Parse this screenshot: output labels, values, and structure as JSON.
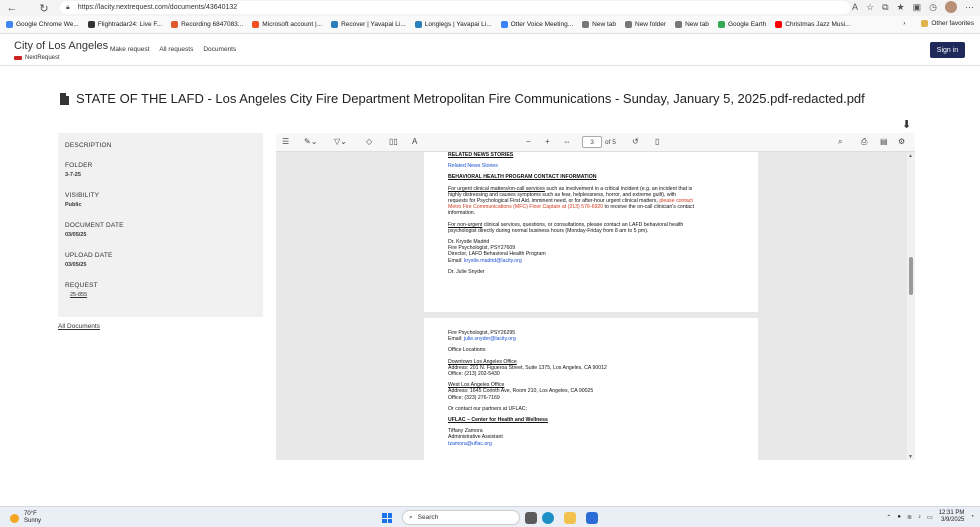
{
  "browser": {
    "url": "https://lacity.nextrequest.com/documents/43640132",
    "bookmarks": [
      {
        "label": "Google Chrome We...",
        "color": "#4285f4"
      },
      {
        "label": "Flightradar24: Live F...",
        "color": "#333333"
      },
      {
        "label": "Recording 6847083...",
        "color": "#e25c2b"
      },
      {
        "label": "Microsoft account |...",
        "color": "#f25022"
      },
      {
        "label": "Recover | Yavapai Li...",
        "color": "#2a7fbd"
      },
      {
        "label": "Longlegs | Yavapai Li...",
        "color": "#2a7fbd"
      },
      {
        "label": "Otter Voice Meeting...",
        "color": "#3b82f6"
      },
      {
        "label": "New tab",
        "color": "#777777"
      },
      {
        "label": "New folder",
        "color": "#777777"
      },
      {
        "label": "New tab",
        "color": "#777777"
      },
      {
        "label": "Google Earth",
        "color": "#34a853"
      },
      {
        "label": "Christmas Jazz Musi...",
        "color": "#ff0000"
      }
    ],
    "other_favorites": "Other favorites"
  },
  "site": {
    "brand": "City of Los Angeles",
    "brand_sub": "NextRequest",
    "nav": {
      "make_request": "Make request",
      "all_requests": "All requests",
      "documents": "Documents"
    },
    "sign_in": "Sign in"
  },
  "document": {
    "title": "STATE OF THE LAFD - Los Angeles City Fire Department Metropolitan Fire Communications - Sunday, January 5, 2025.pdf-redacted.pdf"
  },
  "sidebar": {
    "description_label": "DESCRIPTION",
    "folder_label": "FOLDER",
    "folder_value": "3-7-25",
    "visibility_label": "VISIBILITY",
    "visibility_value": "Public",
    "document_date_label": "DOCUMENT DATE",
    "document_date_value": "03/05/25",
    "upload_date_label": "UPLOAD DATE",
    "upload_date_value": "03/05/25",
    "request_label": "REQUEST",
    "request_value": "25-855",
    "all_documents": "All Documents"
  },
  "viewer": {
    "current_page": "3",
    "total_pages": "of 5",
    "zoom_minus": "−",
    "zoom_plus": "+"
  },
  "page1": {
    "related_heading": "RELATED NEWS STORIES",
    "related_link": "Related News Stories",
    "bhp_heading": "BEHAVIORAL HEALTH PROGRAM CONTACT INFORMATION",
    "urgent_1a": "For urgent clinical matters/on-call services",
    "urgent_1b": " such as involvement in a critical incident (e.g. an incident that is",
    "urgent_2": "highly distressing and causes symptoms such as fear, helplessness, horror, and extreme guilt), with",
    "urgent_3a": "requests for Psychological First Aid, imminent need, or for after-hour urgent clinical matters, ",
    "urgent_3b": "please contact",
    "urgent_4a": "Metro Fire Communications (MFC) Floor Captain at (213) 576-6920",
    "urgent_4b": " to receive the on-call clinician's contact",
    "urgent_5": "information.",
    "nonurgent_1a": "For non-urgent",
    "nonurgent_1b": " clinical services, questions, or consultations, please contact an LAFD behavioral health",
    "nonurgent_2": "psychologist directly during normal business hours (Monday-Friday from 8 am to 5 pm).",
    "madrid_name": "Dr. Krystle Madrid",
    "madrid_title": "Fire Psychologist, PSY27609",
    "madrid_role": "Director, LAFD Behavioral Health Program",
    "madrid_email_label": "Email: ",
    "madrid_email": "krystle.madrid@lacity.org",
    "snyder_name": "Dr. Julie Snyder"
  },
  "page2": {
    "snyder_title": "Fire Psychologist, PSY26295",
    "snyder_email_label": "Email: ",
    "snyder_email": "julie.snyder@lacity.org",
    "office_locations": "Office Locations:",
    "downtown_heading": "Downtown Los Angeles Office",
    "downtown_address": "Address: 201 N. Figueroa Street, Suite 1375, Los Angeles, CA 90012",
    "downtown_phone": "Office: (213) 202-5430",
    "west_heading": "West Los Angeles Office",
    "west_address": "Address: 1645 Corinth Ave, Room 210, Los Angeles, CA 90025",
    "west_phone": "Office: (323) 276-7169",
    "partners": "Or contact our partners at UFLAC:",
    "uflac_heading": "UFLAC – Center for Health and Wellness",
    "tiffany_name": "Tiffany Zamora",
    "tiffany_role": "Administrative Assistant",
    "tiffany_email": "tzamora@uflac.org"
  },
  "taskbar": {
    "temp": "70°F",
    "weather": "Sunny",
    "search": "Search",
    "time": "12:31 PM",
    "date": "3/9/2025"
  }
}
